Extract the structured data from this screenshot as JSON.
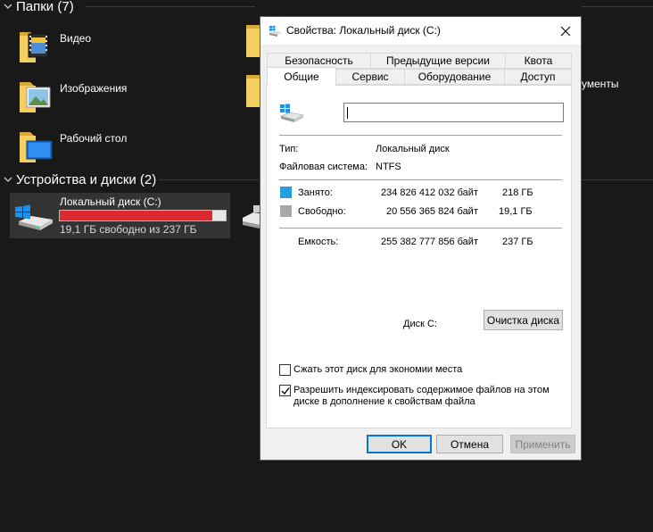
{
  "explorer": {
    "folders_header": "Папки (7)",
    "folders": [
      {
        "label": "Видео",
        "icon": "video-folder-icon"
      },
      {
        "label": "Изображения",
        "icon": "pictures-folder-icon"
      },
      {
        "label": "Рабочий стол",
        "icon": "desktop-folder-icon"
      }
    ],
    "partial_folder_label": "ументы",
    "devices_header": "Устройства и диски (2)",
    "drive": {
      "name": "Локальный диск (C:)",
      "free_text": "19,1 ГБ свободно из 237 ГБ",
      "used_fraction": 0.92,
      "bar_color": "#da2a2f"
    }
  },
  "dialog": {
    "title": "Свойства: Локальный диск (C:)",
    "tabs_row1": [
      "Безопасность",
      "Предыдущие версии",
      "Квота"
    ],
    "tabs_row2": [
      "Общие",
      "Сервис",
      "Оборудование",
      "Доступ"
    ],
    "active_tab": "Общие",
    "name_value": "",
    "type_label": "Тип:",
    "type_value": "Локальный диск",
    "fs_label": "Файловая система:",
    "fs_value": "NTFS",
    "used_label": "Занято:",
    "used_bytes": "234 826 412 032 байт",
    "used_gb": "218 ГБ",
    "free_label": "Свободно:",
    "free_bytes": "20 556 365 824 байт",
    "free_gb": "19,1 ГБ",
    "capacity_label": "Емкость:",
    "capacity_bytes": "255 382 777 856 байт",
    "capacity_gb": "237 ГБ",
    "disk_label": "Диск C:",
    "cleanup_button": "Очистка диска",
    "compress_label": "Сжать этот диск для экономии места",
    "compress_checked": false,
    "index_label_line1": "Разрешить индексировать содержимое файлов на этом",
    "index_label_line2": "диске в дополнение к свойствам файла",
    "index_checked": true,
    "ok_button": "OK",
    "cancel_button": "Отмена",
    "apply_button": "Применить",
    "used_color": "#26a0da",
    "free_color": "#a8a8a8"
  }
}
